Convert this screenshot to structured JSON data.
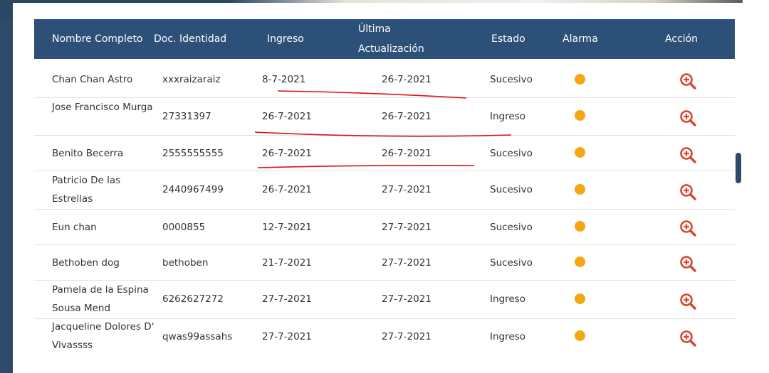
{
  "headers": {
    "nombre": "Nombre Completo",
    "doc": "Doc. Identidad",
    "ingreso": "Ingreso",
    "ultima_1": "Última",
    "ultima_2": "Actualización",
    "estado": "Estado",
    "alarma": "Alarma",
    "accion": "Acción"
  },
  "rows": [
    {
      "name": "Chan Chan Astro",
      "doc": "xxxraizaraiz",
      "ingreso": "8-7-2021",
      "actualizacion": "26-7-2021",
      "estado": "Sucesivo"
    },
    {
      "name": "Jose Francisco Murga",
      "doc": "27331397",
      "ingreso": "26-7-2021",
      "actualizacion": "26-7-2021",
      "estado": "Ingreso"
    },
    {
      "name": "Benito Becerra",
      "doc": "2555555555",
      "ingreso": "26-7-2021",
      "actualizacion": "26-7-2021",
      "estado": "Sucesivo"
    },
    {
      "name": "Patricio De las Estrellas",
      "doc": "2440967499",
      "ingreso": "26-7-2021",
      "actualizacion": "27-7-2021",
      "estado": "Sucesivo"
    },
    {
      "name": "Eun chan",
      "doc": "0000855",
      "ingreso": "12-7-2021",
      "actualizacion": "27-7-2021",
      "estado": "Sucesivo"
    },
    {
      "name": "Bethoben dog",
      "doc": "bethoben",
      "ingreso": "21-7-2021",
      "actualizacion": "27-7-2021",
      "estado": "Sucesivo"
    },
    {
      "name": "Pamela de la Espina Sousa Mend",
      "doc": "6262627272",
      "ingreso": "27-7-2021",
      "actualizacion": "27-7-2021",
      "estado": "Ingreso"
    },
    {
      "name": "Jacqueline Dolores D' Vivassss",
      "doc": "qwas99assahs",
      "ingreso": "27-7-2021",
      "actualizacion": "27-7-2021",
      "estado": "Ingreso"
    }
  ],
  "colors": {
    "header_bg": "#2d5078",
    "alarm_dot": "#f5a712",
    "action_icon": "#d9442b",
    "annotation_line": "#e01010"
  },
  "icons": {
    "alarm": "alarm-dot-icon",
    "action": "zoom-in-icon"
  }
}
